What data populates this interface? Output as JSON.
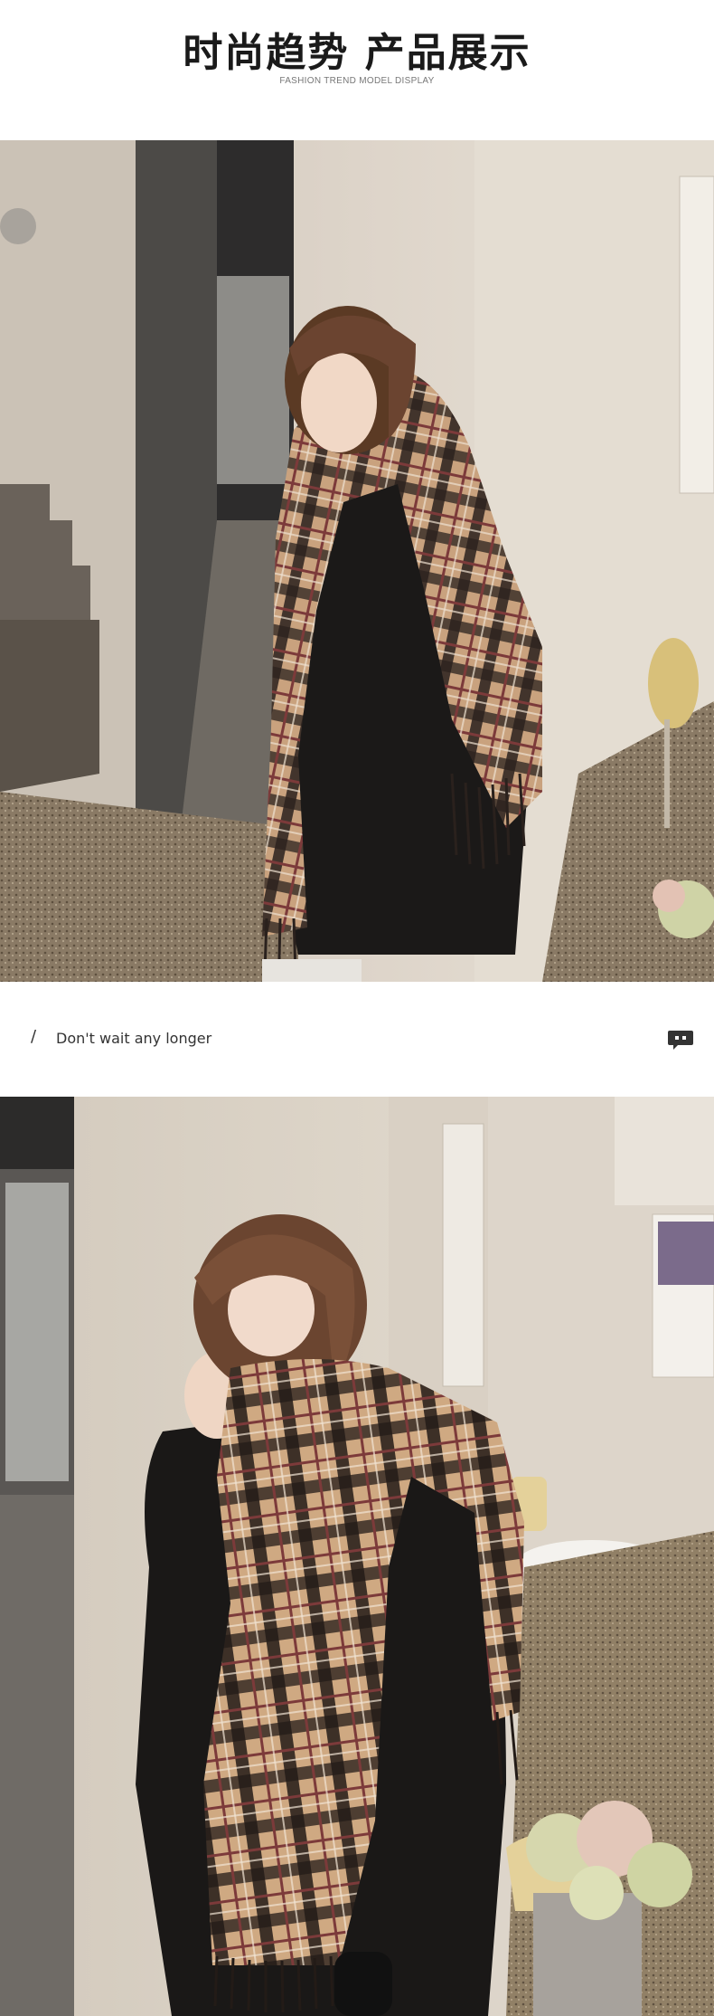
{
  "header": {
    "title": "时尚趋势 产品展示",
    "subtitle": "FASHION TREND MODEL DISPLAY"
  },
  "caption": {
    "slash": "/",
    "text": "Don't wait any longer",
    "icon": "chat-bubble-icon"
  },
  "photos": [
    {
      "name": "model-photo-1",
      "description_icon": "photo"
    },
    {
      "name": "model-photo-2",
      "description_icon": "photo"
    }
  ],
  "colors": {
    "background": "#ffffff",
    "title": "#1a1a1a",
    "wall": "#d9d1c6",
    "coat": "#1b1918",
    "scarf_tan": "#c9a27e",
    "scarf_dark": "#2a211d",
    "scarf_red": "#7c3a3a"
  }
}
